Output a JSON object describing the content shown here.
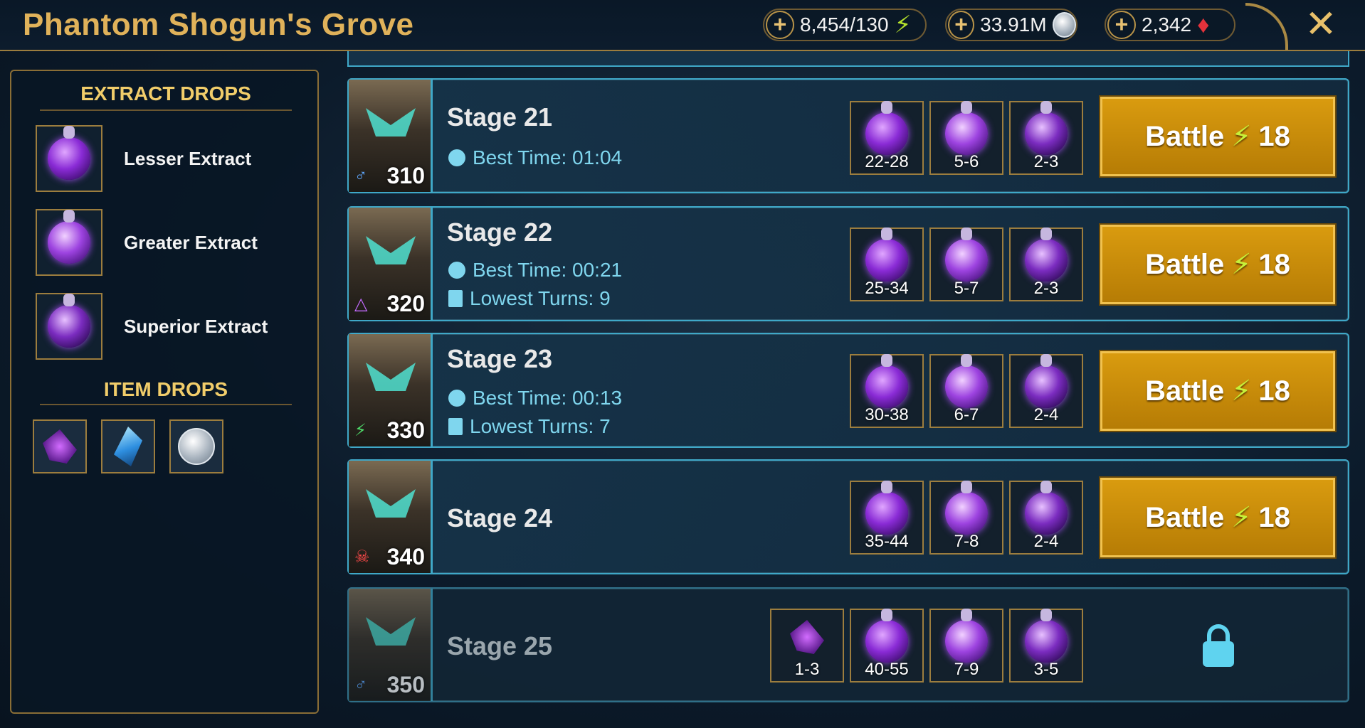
{
  "window": {
    "title": "Phantom Shogun's Grove"
  },
  "resources": [
    {
      "name": "energy",
      "value": "8,454/130",
      "icon": "energy-bolt-icon"
    },
    {
      "name": "silver",
      "value": "33.91M",
      "icon": "silver-coin-icon"
    },
    {
      "name": "gems",
      "value": "2,342",
      "icon": "ruby-gem-icon"
    }
  ],
  "sidebar": {
    "extract_heading": "EXTRACT DROPS",
    "extracts": [
      {
        "label": "Lesser Extract"
      },
      {
        "label": "Greater Extract"
      },
      {
        "label": "Superior Extract"
      }
    ],
    "item_heading": "ITEM DROPS"
  },
  "stages": [
    {
      "name": "Stage 21",
      "level": "310",
      "best_time_label": "Best Time: 01:04",
      "lowest_turns_label": "",
      "rewards": [
        "22-28",
        "5-6",
        "2-3"
      ],
      "battle_label": "Battle",
      "energy_cost": "18",
      "locked": false
    },
    {
      "name": "Stage 22",
      "level": "320",
      "best_time_label": "Best Time: 00:21",
      "lowest_turns_label": "Lowest Turns: 9",
      "rewards": [
        "25-34",
        "5-7",
        "2-3"
      ],
      "battle_label": "Battle",
      "energy_cost": "18",
      "locked": false
    },
    {
      "name": "Stage 23",
      "level": "330",
      "best_time_label": "Best Time: 00:13",
      "lowest_turns_label": "Lowest Turns: 7",
      "rewards": [
        "30-38",
        "6-7",
        "2-4"
      ],
      "battle_label": "Battle",
      "energy_cost": "18",
      "locked": false
    },
    {
      "name": "Stage 24",
      "level": "340",
      "best_time_label": "",
      "lowest_turns_label": "",
      "rewards": [
        "35-44",
        "7-8",
        "2-4"
      ],
      "battle_label": "Battle",
      "energy_cost": "18",
      "locked": false
    },
    {
      "name": "Stage 25",
      "level": "350",
      "best_time_label": "",
      "lowest_turns_label": "",
      "rewards": [
        "1-3",
        "40-55",
        "7-9",
        "3-5"
      ],
      "locked": true
    }
  ],
  "colors": {
    "accent_gold": "#e0b25a",
    "stage_border": "#3fa8c8",
    "battle_button": "#d99b0f"
  }
}
